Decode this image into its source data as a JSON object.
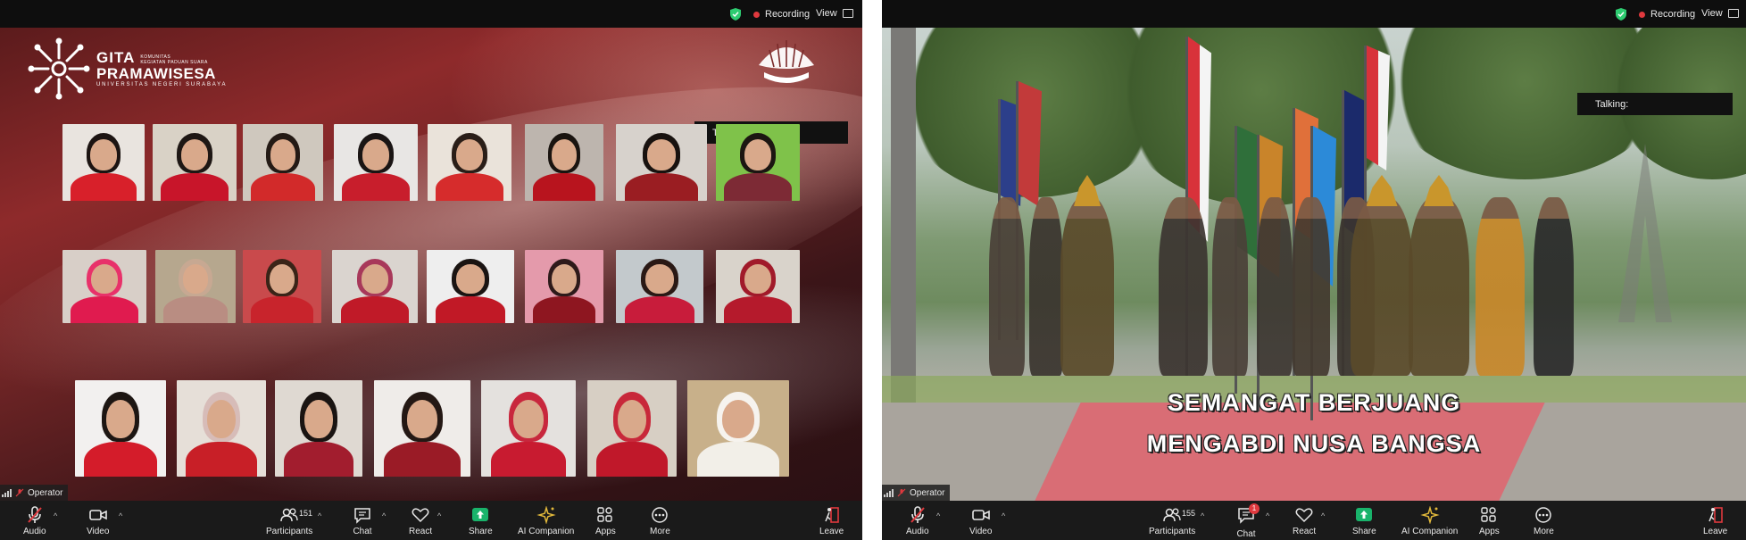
{
  "colors": {
    "toolbar": "#1a1a1a",
    "recording_dot": "#e0393e",
    "shield": "#2ecc71",
    "share_green": "#19b36b",
    "companion_gold": "#e2b93b"
  },
  "left_window": {
    "recording_label": "Recording",
    "view_label": "View",
    "talking_label": "Talking:",
    "operator_label": "Operator",
    "logo": {
      "line1": "GITA",
      "line2": "PRAMAWISESA",
      "small_line1": "KOMUNITAS",
      "small_line2": "KEGIATAN PADUAN SUARA",
      "university": "UNIVERSITAS NEGERI SURABAYA"
    },
    "participants_count": "151",
    "toolbar": {
      "audio": "Audio",
      "video": "Video",
      "participants": "Participants",
      "chat": "Chat",
      "react": "React",
      "share": "Share",
      "ai_companion": "AI Companion",
      "apps": "Apps",
      "more": "More",
      "leave": "Leave"
    }
  },
  "right_window": {
    "recording_label": "Recording",
    "view_label": "View",
    "talking_label": "Talking:",
    "operator_label": "Operator",
    "subtitle_line1": "SEMANGAT BERJUANG",
    "subtitle_line2": "MENGABDI NUSA BANGSA",
    "participants_count": "155",
    "chat_badge": "1",
    "toolbar": {
      "audio": "Audio",
      "video": "Video",
      "participants": "Participants",
      "chat": "Chat",
      "react": "React",
      "share": "Share",
      "ai_companion": "AI Companion",
      "apps": "Apps",
      "more": "More",
      "leave": "Leave"
    }
  }
}
